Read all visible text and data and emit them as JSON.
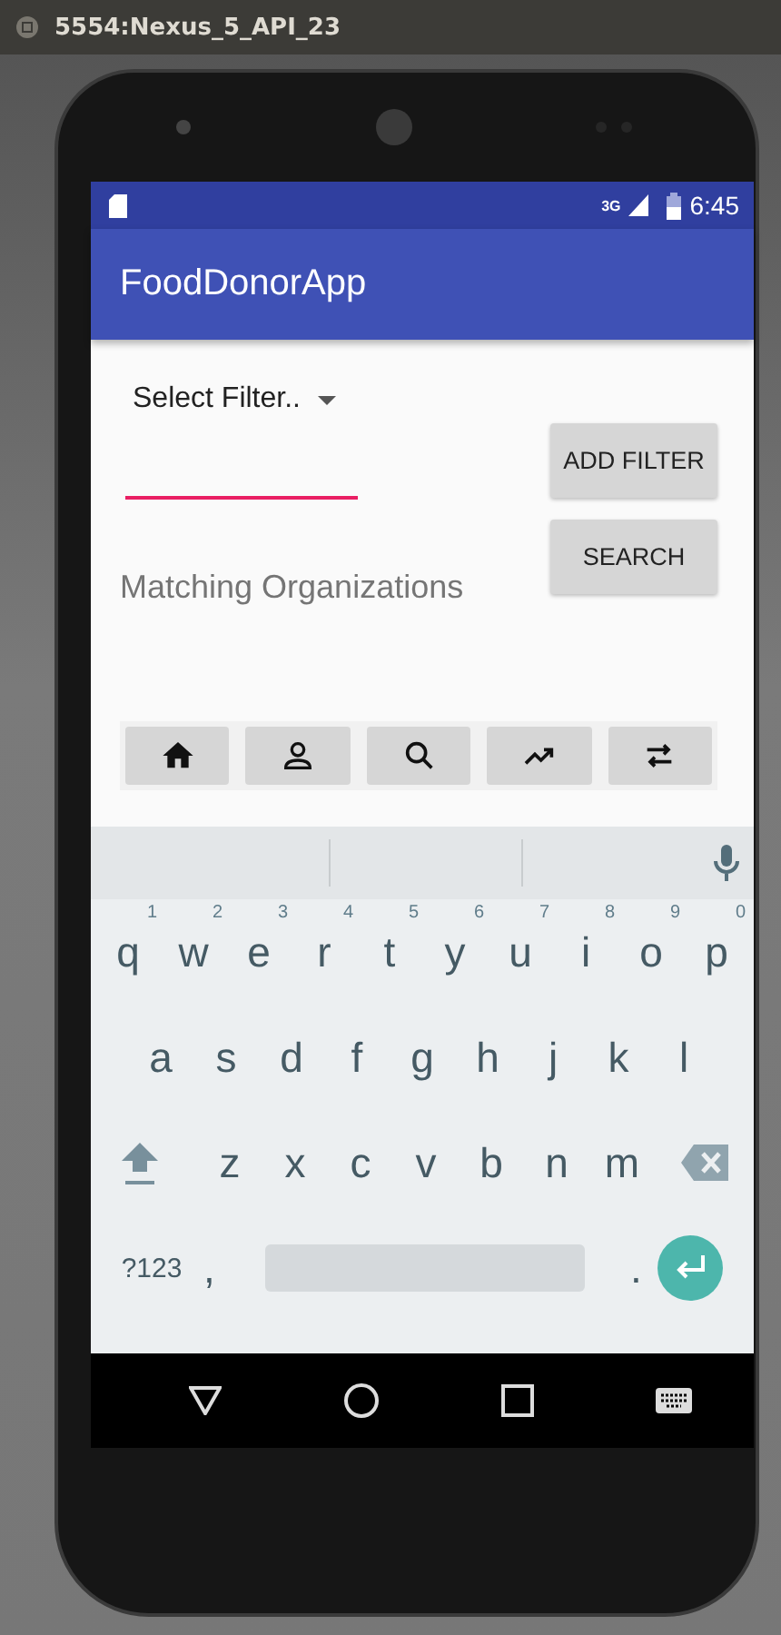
{
  "window": {
    "title": "5554:Nexus_5_API_23"
  },
  "status_bar": {
    "network": "3G",
    "time": "6:45"
  },
  "app_bar": {
    "title": "FoodDonorApp"
  },
  "filter_spinner": {
    "label": "Select Filter.."
  },
  "filter_input": {
    "focused": true
  },
  "buttons": [
    "ADD FILTER",
    "SEARCH"
  ],
  "results_label": "Matching Organizations",
  "toolbar": [
    {
      "kind": "home"
    },
    {
      "kind": "person"
    },
    {
      "kind": "search"
    },
    {
      "kind": "trend"
    },
    {
      "kind": "swap"
    }
  ],
  "keyboard": {
    "rows": [
      [
        {
          "key": "q",
          "hint": "1"
        },
        {
          "key": "w",
          "hint": "2"
        },
        {
          "key": "e",
          "hint": "3"
        },
        {
          "key": "r",
          "hint": "4"
        },
        {
          "key": "t",
          "hint": "5"
        },
        {
          "key": "y",
          "hint": "6"
        },
        {
          "key": "u",
          "hint": "7"
        },
        {
          "key": "i",
          "hint": "8"
        },
        {
          "key": "o",
          "hint": "9"
        },
        {
          "key": "p",
          "hint": "0"
        }
      ],
      [
        {
          "key": "a"
        },
        {
          "key": "s"
        },
        {
          "key": "d"
        },
        {
          "key": "f"
        },
        {
          "key": "g"
        },
        {
          "key": "h"
        },
        {
          "key": "j"
        },
        {
          "key": "k"
        },
        {
          "key": "l"
        }
      ],
      [
        {
          "key": "z"
        },
        {
          "key": "x"
        },
        {
          "key": "c"
        },
        {
          "key": "v"
        },
        {
          "key": "b"
        },
        {
          "key": "n"
        },
        {
          "key": "m"
        }
      ]
    ],
    "symbols_key": "?123",
    "comma_key": ",",
    "period_key": "."
  }
}
